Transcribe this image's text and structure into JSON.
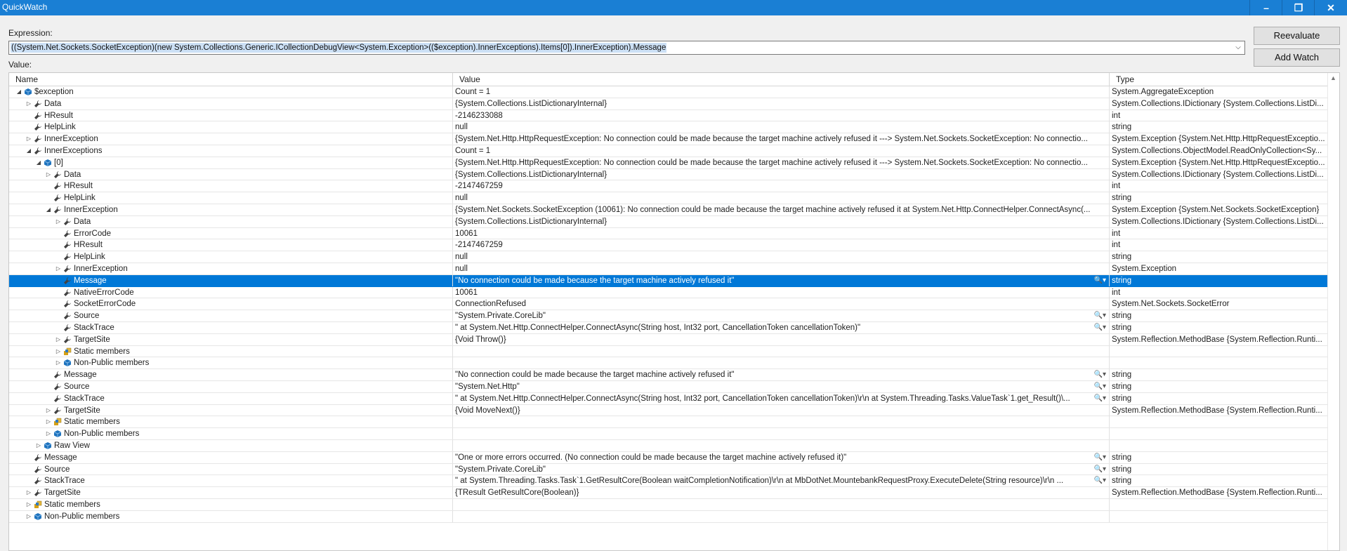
{
  "window": {
    "title": "QuickWatch",
    "minimize": "–",
    "restore": "❐",
    "close": "✕"
  },
  "expression": {
    "label": "Expression:",
    "value": "((System.Net.Sockets.SocketException)(new System.Collections.Generic.ICollectionDebugView<System.Exception>(($exception).InnerExceptions).Items[0]).InnerException).Message"
  },
  "buttons": {
    "reevaluate": "Reevaluate",
    "add_watch": "Add Watch"
  },
  "value_label": "Value:",
  "columns": {
    "name": "Name",
    "value": "Value",
    "type": "Type"
  },
  "icon_names": {
    "wrench": "property-wrench-icon",
    "cube": "object-cube-icon",
    "static": "static-members-icon",
    "magnifier": "visualizer-magnifier-icon"
  },
  "rows": [
    {
      "depth": 0,
      "expander": "open",
      "icon": "cube",
      "name": "$exception",
      "value": "Count = 1",
      "type": "System.AggregateException",
      "viz": false
    },
    {
      "depth": 1,
      "expander": "closed",
      "icon": "wrench",
      "name": "Data",
      "value": "{System.Collections.ListDictionaryInternal}",
      "type": "System.Collections.IDictionary {System.Collections.ListDi...",
      "viz": false
    },
    {
      "depth": 1,
      "expander": "",
      "icon": "wrench",
      "name": "HResult",
      "value": "-2146233088",
      "type": "int",
      "viz": false
    },
    {
      "depth": 1,
      "expander": "",
      "icon": "wrench",
      "name": "HelpLink",
      "value": "null",
      "type": "string",
      "viz": false
    },
    {
      "depth": 1,
      "expander": "closed",
      "icon": "wrench",
      "name": "InnerException",
      "value": "{System.Net.Http.HttpRequestException: No connection could be made because the target machine actively refused it ---> System.Net.Sockets.SocketException: No connectio...",
      "type": "System.Exception {System.Net.Http.HttpRequestExceptio...",
      "viz": false
    },
    {
      "depth": 1,
      "expander": "open",
      "icon": "wrench",
      "name": "InnerExceptions",
      "value": "Count = 1",
      "type": "System.Collections.ObjectModel.ReadOnlyCollection<Sy...",
      "viz": false
    },
    {
      "depth": 2,
      "expander": "open",
      "icon": "cube",
      "name": "[0]",
      "value": "{System.Net.Http.HttpRequestException: No connection could be made because the target machine actively refused it ---> System.Net.Sockets.SocketException: No connectio...",
      "type": "System.Exception {System.Net.Http.HttpRequestExceptio...",
      "viz": false
    },
    {
      "depth": 3,
      "expander": "closed",
      "icon": "wrench",
      "name": "Data",
      "value": "{System.Collections.ListDictionaryInternal}",
      "type": "System.Collections.IDictionary {System.Collections.ListDi...",
      "viz": false
    },
    {
      "depth": 3,
      "expander": "",
      "icon": "wrench",
      "name": "HResult",
      "value": "-2147467259",
      "type": "int",
      "viz": false
    },
    {
      "depth": 3,
      "expander": "",
      "icon": "wrench",
      "name": "HelpLink",
      "value": "null",
      "type": "string",
      "viz": false
    },
    {
      "depth": 3,
      "expander": "open",
      "icon": "wrench",
      "name": "InnerException",
      "value": "{System.Net.Sockets.SocketException (10061): No connection could be made because the target machine actively refused it    at System.Net.Http.ConnectHelper.ConnectAsync(...",
      "type": "System.Exception {System.Net.Sockets.SocketException}",
      "viz": false
    },
    {
      "depth": 4,
      "expander": "closed",
      "icon": "wrench",
      "name": "Data",
      "value": "{System.Collections.ListDictionaryInternal}",
      "type": "System.Collections.IDictionary {System.Collections.ListDi...",
      "viz": false
    },
    {
      "depth": 4,
      "expander": "",
      "icon": "wrench",
      "name": "ErrorCode",
      "value": "10061",
      "type": "int",
      "viz": false
    },
    {
      "depth": 4,
      "expander": "",
      "icon": "wrench",
      "name": "HResult",
      "value": "-2147467259",
      "type": "int",
      "viz": false
    },
    {
      "depth": 4,
      "expander": "",
      "icon": "wrench",
      "name": "HelpLink",
      "value": "null",
      "type": "string",
      "viz": false
    },
    {
      "depth": 4,
      "expander": "closed",
      "icon": "wrench",
      "name": "InnerException",
      "value": "null",
      "type": "System.Exception",
      "viz": false
    },
    {
      "depth": 4,
      "expander": "",
      "icon": "wrench",
      "name": "Message",
      "value": "\"No connection could be made because the target machine actively refused it\"",
      "type": "string",
      "viz": true,
      "selected": true
    },
    {
      "depth": 4,
      "expander": "",
      "icon": "wrench",
      "name": "NativeErrorCode",
      "value": "10061",
      "type": "int",
      "viz": false
    },
    {
      "depth": 4,
      "expander": "",
      "icon": "wrench",
      "name": "SocketErrorCode",
      "value": "ConnectionRefused",
      "type": "System.Net.Sockets.SocketError",
      "viz": false
    },
    {
      "depth": 4,
      "expander": "",
      "icon": "wrench",
      "name": "Source",
      "value": "\"System.Private.CoreLib\"",
      "type": "string",
      "viz": true
    },
    {
      "depth": 4,
      "expander": "",
      "icon": "wrench",
      "name": "StackTrace",
      "value": "\"   at System.Net.Http.ConnectHelper.ConnectAsync(String host, Int32 port, CancellationToken cancellationToken)\"",
      "type": "string",
      "viz": true
    },
    {
      "depth": 4,
      "expander": "closed",
      "icon": "wrench",
      "name": "TargetSite",
      "value": "{Void Throw()}",
      "type": "System.Reflection.MethodBase {System.Reflection.Runti...",
      "viz": false
    },
    {
      "depth": 4,
      "expander": "closed",
      "icon": "static",
      "name": "Static members",
      "value": "",
      "type": "",
      "viz": false
    },
    {
      "depth": 4,
      "expander": "closed",
      "icon": "cube",
      "name": "Non-Public members",
      "value": "",
      "type": "",
      "viz": false
    },
    {
      "depth": 3,
      "expander": "",
      "icon": "wrench",
      "name": "Message",
      "value": "\"No connection could be made because the target machine actively refused it\"",
      "type": "string",
      "viz": true
    },
    {
      "depth": 3,
      "expander": "",
      "icon": "wrench",
      "name": "Source",
      "value": "\"System.Net.Http\"",
      "type": "string",
      "viz": true
    },
    {
      "depth": 3,
      "expander": "",
      "icon": "wrench",
      "name": "StackTrace",
      "value": "\"   at System.Net.Http.ConnectHelper.ConnectAsync(String host, Int32 port, CancellationToken cancellationToken)\\r\\n   at System.Threading.Tasks.ValueTask`1.get_Result()\\...",
      "type": "string",
      "viz": true
    },
    {
      "depth": 3,
      "expander": "closed",
      "icon": "wrench",
      "name": "TargetSite",
      "value": "{Void MoveNext()}",
      "type": "System.Reflection.MethodBase {System.Reflection.Runti...",
      "viz": false
    },
    {
      "depth": 3,
      "expander": "closed",
      "icon": "static",
      "name": "Static members",
      "value": "",
      "type": "",
      "viz": false
    },
    {
      "depth": 3,
      "expander": "closed",
      "icon": "cube",
      "name": "Non-Public members",
      "value": "",
      "type": "",
      "viz": false
    },
    {
      "depth": 2,
      "expander": "closed",
      "icon": "cube",
      "name": "Raw View",
      "value": "",
      "type": "",
      "viz": false
    },
    {
      "depth": 1,
      "expander": "",
      "icon": "wrench",
      "name": "Message",
      "value": "\"One or more errors occurred. (No connection could be made because the target machine actively refused it)\"",
      "type": "string",
      "viz": true
    },
    {
      "depth": 1,
      "expander": "",
      "icon": "wrench",
      "name": "Source",
      "value": "\"System.Private.CoreLib\"",
      "type": "string",
      "viz": true
    },
    {
      "depth": 1,
      "expander": "",
      "icon": "wrench",
      "name": "StackTrace",
      "value": "\"   at System.Threading.Tasks.Task`1.GetResultCore(Boolean waitCompletionNotification)\\r\\n   at MbDotNet.MountebankRequestProxy.ExecuteDelete(String resource)\\r\\n ...",
      "type": "string",
      "viz": true
    },
    {
      "depth": 1,
      "expander": "closed",
      "icon": "wrench",
      "name": "TargetSite",
      "value": "{TResult GetResultCore(Boolean)}",
      "type": "System.Reflection.MethodBase {System.Reflection.Runti...",
      "viz": false
    },
    {
      "depth": 1,
      "expander": "closed",
      "icon": "static",
      "name": "Static members",
      "value": "",
      "type": "",
      "viz": false
    },
    {
      "depth": 1,
      "expander": "closed",
      "icon": "cube",
      "name": "Non-Public members",
      "value": "",
      "type": "",
      "viz": false
    }
  ]
}
